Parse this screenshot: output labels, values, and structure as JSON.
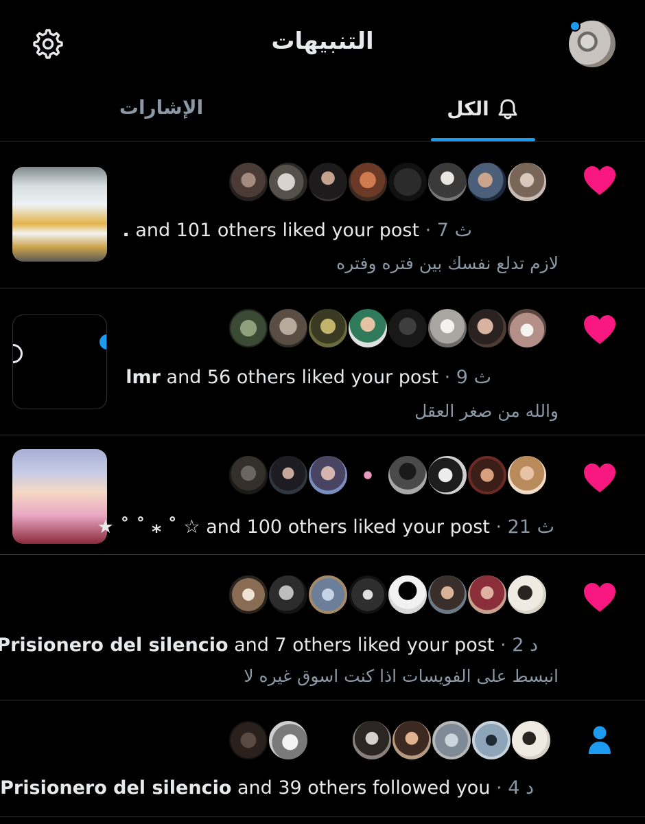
{
  "header": {
    "title": "التنبيهات"
  },
  "tabs": {
    "all": "الكل",
    "mentions": "الإشارات"
  },
  "colors": {
    "accent": "#1d9bf0",
    "like": "#f91880",
    "background": "#000000",
    "muted": "#8b98a5"
  },
  "notifications": [
    {
      "type": "like",
      "icon": "heart-icon",
      "actor": ".",
      "rest": " and 101 others liked your post",
      "time": " · 7 ث",
      "snippet": "لازم تدلع نفسك بين فتره وفتره"
    },
    {
      "type": "like",
      "icon": "heart-icon",
      "actor": "lmr",
      "rest": " and 56 others liked your post",
      "time": " · 9 ث",
      "snippet": "والله من صغر العقل"
    },
    {
      "type": "like",
      "icon": "heart-icon",
      "actor": "★ ˚ ˚ ⁎ ˚ ☆",
      "rest": " and 100 others liked your post",
      "time": " · 21 ث",
      "snippet": ""
    },
    {
      "type": "like",
      "icon": "heart-icon",
      "actor": "Prisionero del silencio",
      "rest": " and 7 others liked your post",
      "time": " · 2 د",
      "snippet": "انبسط على الفويسات اذا كنت اسوق غيره لا"
    },
    {
      "type": "follow",
      "icon": "person-icon",
      "actor": "Prisionero del silencio",
      "rest": " and 39 others followed you",
      "time": " · 4 د",
      "snippet": ""
    }
  ]
}
